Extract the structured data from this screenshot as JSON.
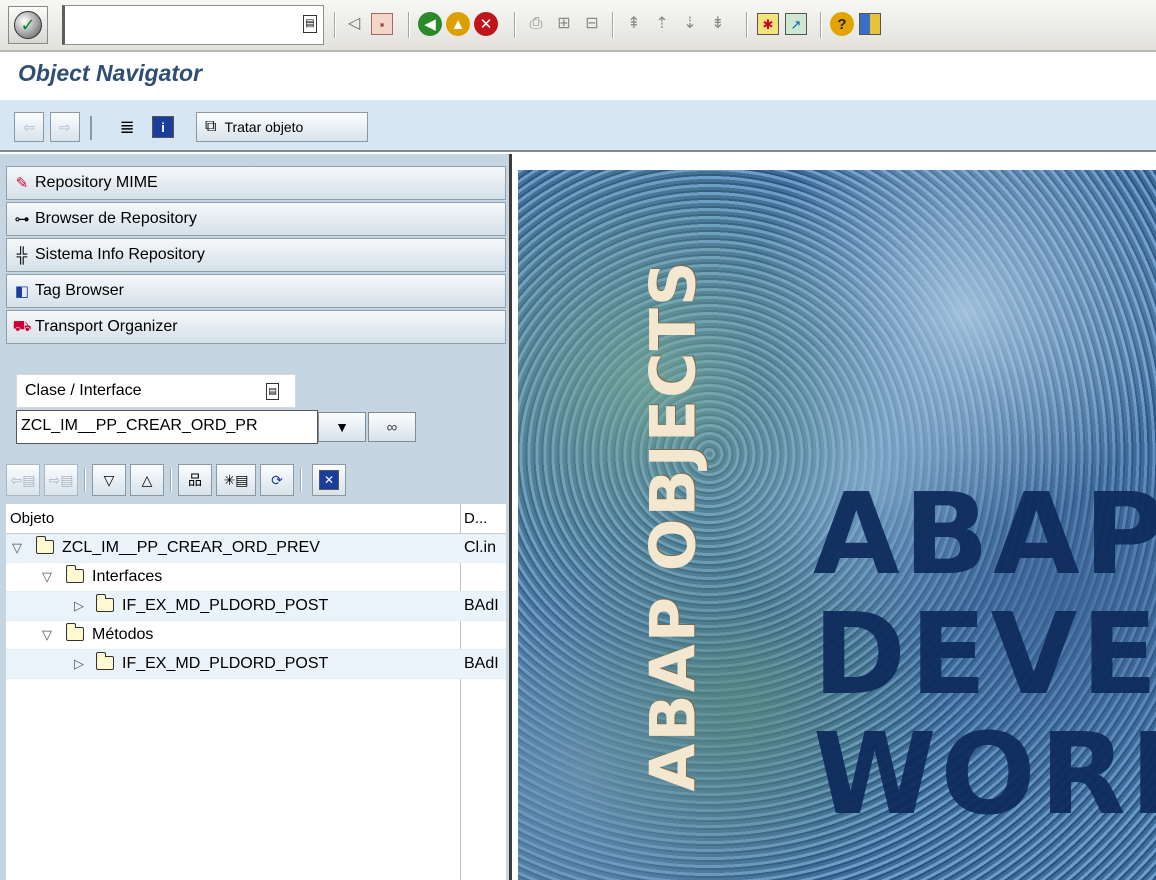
{
  "system_toolbar": {
    "command_field_value": "",
    "command_history_glyph": "▤"
  },
  "title": "Object Navigator",
  "app_toolbar": {
    "edit_object_label": "Tratar objeto"
  },
  "navigator": {
    "buttons": [
      {
        "label": "Repository MIME",
        "icon": "mime-icon"
      },
      {
        "label": "Browser de Repository",
        "icon": "hierarchy-icon"
      },
      {
        "label": "Sistema Info Repository",
        "icon": "info-system-icon"
      },
      {
        "label": "Tag Browser",
        "icon": "tag-icon"
      },
      {
        "label": "Transport Organizer",
        "icon": "truck-icon"
      }
    ],
    "object_type": "Clase / Interface",
    "object_name": "ZCL_IM__PP_CREAR_ORD_PR",
    "tree": {
      "columns": [
        "Objeto",
        "D..."
      ],
      "rows": [
        {
          "label": "ZCL_IM__PP_CREAR_ORD_PREV",
          "desc": "Cl.in",
          "level": 0,
          "expanded": true
        },
        {
          "label": "Interfaces",
          "desc": "",
          "level": 1,
          "expanded": true
        },
        {
          "label": "IF_EX_MD_PLDORD_POST",
          "desc": "BAdI",
          "level": 2,
          "expanded": false
        },
        {
          "label": "Métodos",
          "desc": "",
          "level": 1,
          "expanded": true
        },
        {
          "label": "IF_EX_MD_PLDORD_POST",
          "desc": "BAdI",
          "level": 2,
          "expanded": false
        }
      ]
    }
  },
  "artwork": {
    "vertical_text": "ABAP OBJECTS",
    "line1": "ABAP",
    "line2": "DEVEL",
    "line3": "WORK"
  },
  "colors": {
    "title": "#2e4e75",
    "app_toolbar_bg": "#d6e6f2",
    "navigator_bg": "#c6d5e2",
    "art_text": "#0f2c5c"
  }
}
